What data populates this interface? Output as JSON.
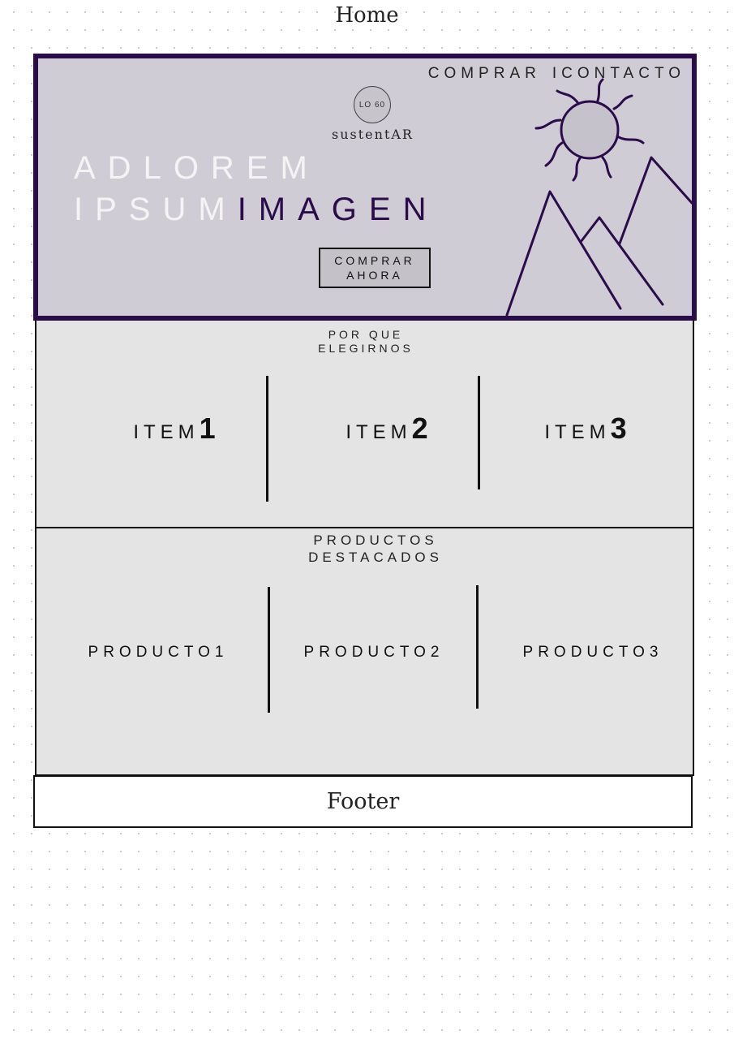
{
  "page": {
    "title": "Home"
  },
  "hero": {
    "nav": [
      "COMPRAR",
      "ICONTACTO"
    ],
    "logo_text": "LO 60",
    "brand": "sustentAR",
    "headline_line1": "ADLOREM",
    "headline_line2_light": "IPSUM",
    "headline_line2_accent": "IMAGEN",
    "cta_label": "COMPRAR AHORA",
    "image_placeholder_icon": "sun-and-mountains-icon"
  },
  "why": {
    "title": "POR QUE ELEGIRNOS",
    "items": [
      {
        "word": "ITEM",
        "num": "1"
      },
      {
        "word": "ITEM",
        "num": "2"
      },
      {
        "word": "ITEM",
        "num": "3"
      }
    ]
  },
  "featured": {
    "title": "PRODUCTOS DESTACADOS",
    "products": [
      "PRODUCTO1",
      "PRODUCTO2",
      "PRODUCTO3"
    ]
  },
  "footer": {
    "label": "Footer"
  },
  "colors": {
    "accent": "#2b0c4a",
    "hero_bg": "#d0ccd6",
    "section_bg": "#e4e4e4"
  }
}
